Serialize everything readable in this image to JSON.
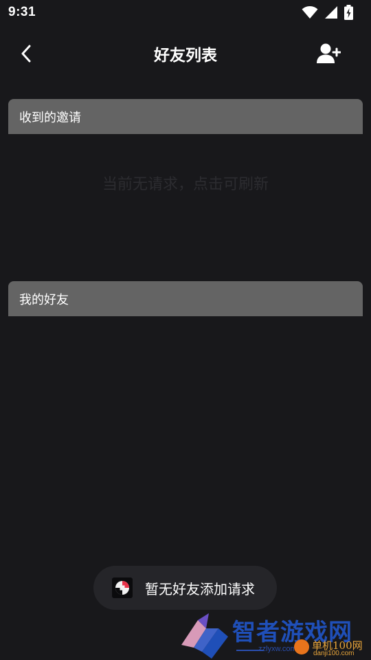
{
  "status_bar": {
    "time": "9:31",
    "icons": [
      "wifi-icon",
      "cell-signal-icon",
      "battery-charging-icon"
    ]
  },
  "app_bar": {
    "title": "好友列表",
    "back_icon": "chevron-left-icon",
    "add_friend_icon": "add-user-icon"
  },
  "sections": {
    "invitations": {
      "header": "收到的邀请",
      "empty_hint": "当前无请求，点击可刷新"
    },
    "friends": {
      "header": "我的好友"
    }
  },
  "toast": {
    "message": "暂无好友添加请求"
  },
  "watermark": {
    "name": "智者游戏网",
    "sub": "zzlyxw.com",
    "secondary_name": "单机100网",
    "secondary_url": "danji100.com"
  },
  "colors": {
    "background": "#18181b",
    "section_header": "#646464",
    "hint_text": "#2c2c30",
    "toast_background": "#252529",
    "watermark_blue": "#1f4fb8",
    "watermark_orange": "#e8a53a"
  }
}
